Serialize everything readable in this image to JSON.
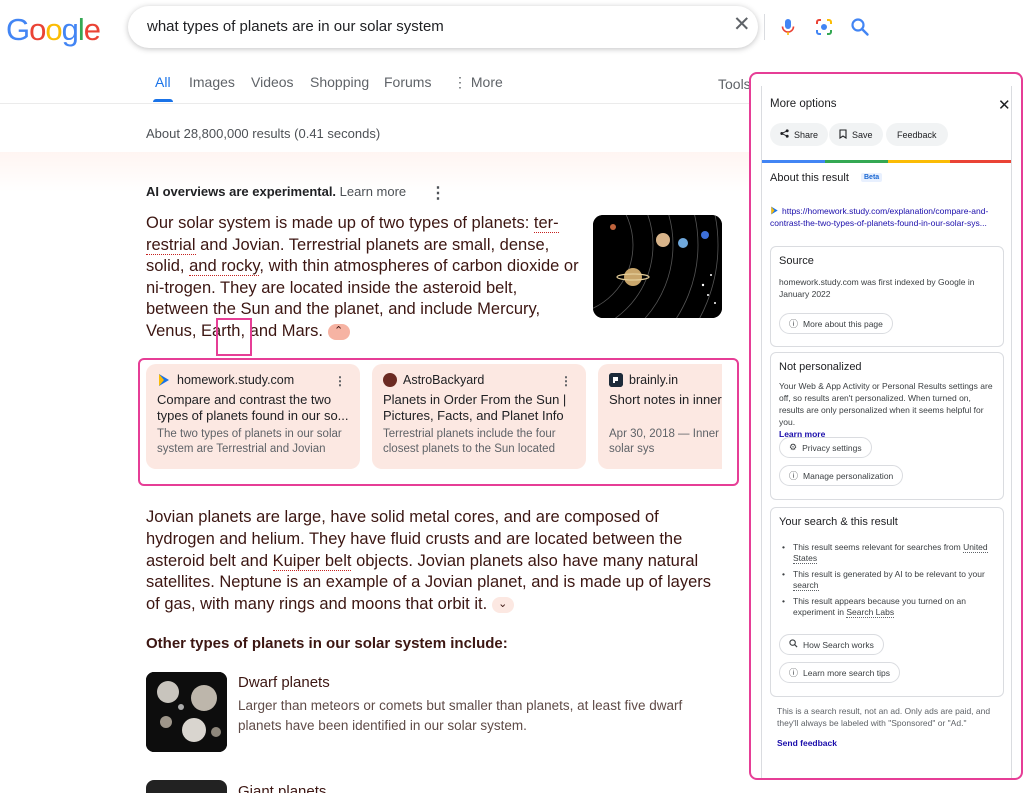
{
  "logo": {
    "text": "Google",
    "letters": [
      "G",
      "o",
      "o",
      "g",
      "l",
      "e"
    ],
    "colors": [
      "#4285f4",
      "#ea4335",
      "#fbbc05",
      "#4285f4",
      "#34a853",
      "#ea4335"
    ]
  },
  "search": {
    "query": "what types of planets are in our solar system",
    "clear_icon": "close-icon",
    "mic_icon": "mic-icon",
    "lens_icon": "lens-icon",
    "search_icon": "search-icon"
  },
  "tabs": [
    {
      "label": "All",
      "active": true
    },
    {
      "label": "Images"
    },
    {
      "label": "Videos"
    },
    {
      "label": "Shopping"
    },
    {
      "label": "Forums"
    },
    {
      "label": "More",
      "icon": "vertical-dots-icon"
    }
  ],
  "tools_label": "Tools",
  "results_stats": "About 28,800,000 results (0.41 seconds)",
  "ai_overview": {
    "header": "AI overviews are experimental.",
    "learn_more": "Learn more",
    "para1_a": "Our solar system is made up of two types of planets: ",
    "para1_term": "ter-restrial",
    "para1_b": " and Jovian. Terrestrial planets are small, dense, solid, ",
    "para1_c": "and rocky",
    "para1_d": ", with thin atmospheres of carbon dioxide or ni-trogen. They are located inside the asteroid belt, between the Sun and the planet, and include Mercury, Venus, Earth, and Mars.",
    "sources": [
      {
        "site": "homework.study.com",
        "fav_color": "#1a73e8",
        "title": "Compare and contrast the two types of planets found in our so...",
        "snippet": "The two types of planets in our solar system are Terrestrial and Jovian pla..."
      },
      {
        "site": "AstroBackyard",
        "fav_color": "#8b3a2f",
        "title": "Planets in Order From the Sun | Pictures, Facts, and Planet Info",
        "snippet": "Terrestrial planets include the four closest planets to the Sun located be..."
      },
      {
        "site": "brainly.in",
        "fav_color": "#1d2b3a",
        "title": "Short notes in inner",
        "snippet": "Apr 30, 2018 — Inner p planets in the solar sys"
      }
    ],
    "para2_a": "Jovian planets are large, have solid metal cores, and are composed of hydrogen and helium. They have fluid crusts and are located between the asteroid belt and ",
    "para2_term": "Kuiper belt",
    "para2_b": " objects. Jovian planets also have many natural satellites. Neptune is an example of a Jovian planet, and is made up of layers of gas, with many rings and moons that orbit it.",
    "other_heading": "Other types of planets in our solar system include:",
    "items": [
      {
        "title": "Dwarf planets",
        "description": "Larger than meteors or comets but smaller than planets, at least five dwarf planets have been identified in our solar system."
      },
      {
        "title": "Giant planets"
      }
    ]
  },
  "panel": {
    "header": "More options",
    "buttons": [
      {
        "label": "Share",
        "icon": "share-icon"
      },
      {
        "label": "Save",
        "icon": "bookmark-icon"
      },
      {
        "label": "Feedback"
      }
    ],
    "rainbow": [
      "#4285f4",
      "#34a853",
      "#fbbc05",
      "#ea4335"
    ],
    "about_title": "About this result",
    "beta": "Beta",
    "link": "https://homework.study.com/explanation/compare-and-contrast-the-two-types-of-planets-found-in-our-solar-sys...",
    "source": {
      "heading": "Source",
      "text": "homework.study.com was first indexed by Google in January 2022",
      "button": "More about this page"
    },
    "personalized": {
      "heading": "Not personalized",
      "text": "Your Web & App Activity or Personal Results settings are off, so results aren't personalized. When turned on, results are only personalized when it seems helpful for you.",
      "learn_more": "Learn more",
      "privacy_button": "Privacy settings",
      "manage_button": "Manage personalization"
    },
    "your_search": {
      "heading": "Your search & this result",
      "b1_a": "This result seems relevant for searches from ",
      "b1_link": "United States",
      "b2_a": "This result is generated by AI to be relevant to your ",
      "b2_link": "search",
      "b3_a": "This result appears because you turned on an experiment in ",
      "b3_link": "Search Labs",
      "how_button": "How Search works",
      "tips_button": "Learn more search tips"
    },
    "footer": "This is a search result, not an ad. Only ads are paid, and they'll always be labeled with \"Sponsored\" or \"Ad.\"",
    "send_feedback": "Send feedback"
  }
}
